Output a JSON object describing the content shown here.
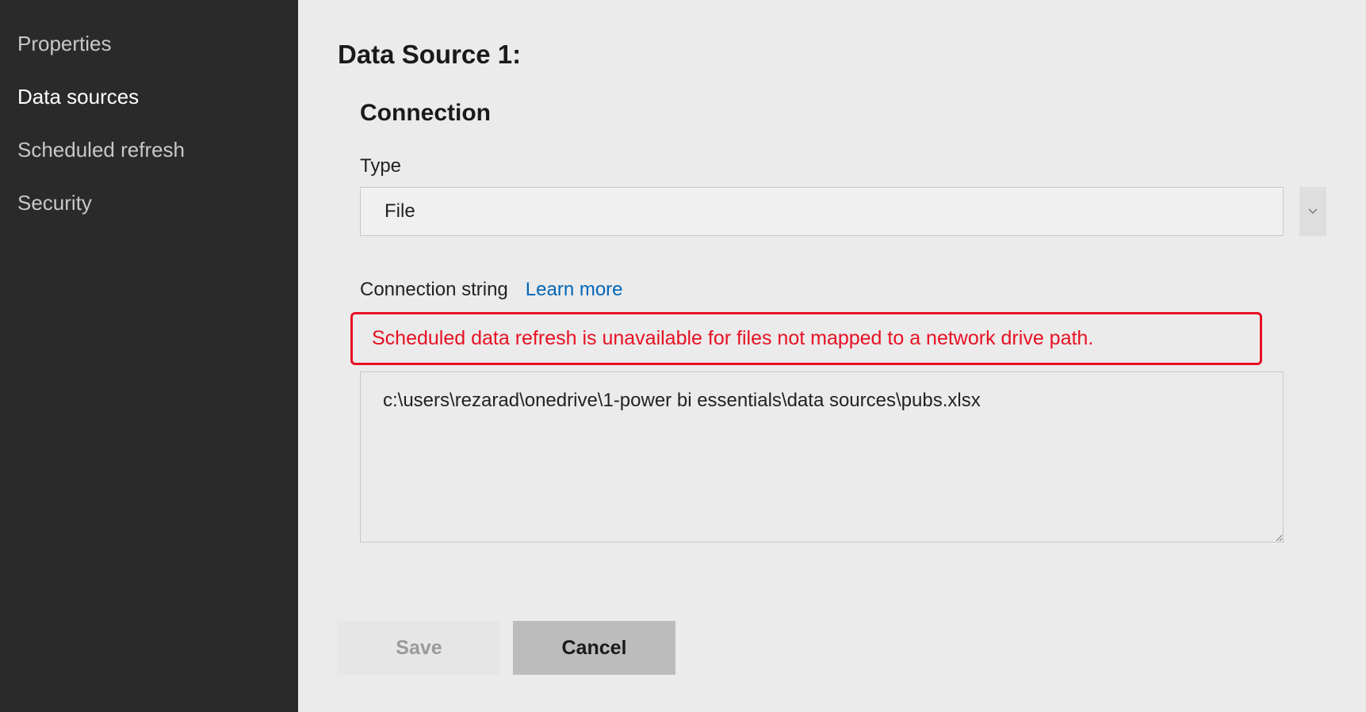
{
  "sidebar": {
    "items": [
      {
        "label": "Properties",
        "active": false
      },
      {
        "label": "Data sources",
        "active": true
      },
      {
        "label": "Scheduled refresh",
        "active": false
      },
      {
        "label": "Security",
        "active": false
      }
    ]
  },
  "main": {
    "title": "Data Source 1:",
    "section_title": "Connection",
    "type_label": "Type",
    "type_value": "File",
    "connection_string_label": "Connection string",
    "learn_more_label": "Learn more",
    "error_message": "Scheduled data refresh is unavailable for files not mapped to a network drive path.",
    "connection_string_value": "c:\\users\\rezarad\\onedrive\\1-power bi essentials\\data sources\\pubs.xlsx"
  },
  "buttons": {
    "save_label": "Save",
    "cancel_label": "Cancel"
  }
}
